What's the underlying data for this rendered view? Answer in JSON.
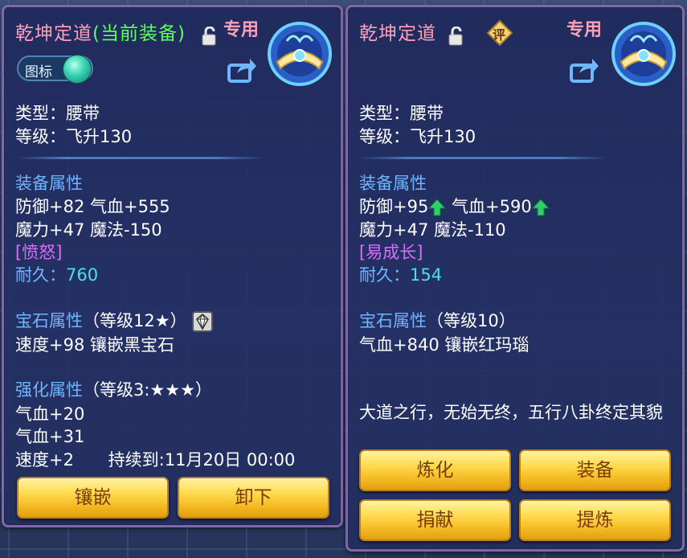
{
  "left_panel": {
    "title": "乾坤定道",
    "title_tag": "(当前装备)",
    "exclusive": "专用",
    "icon_toggle_label": "图标",
    "type_line": "类型：腰带",
    "level_line": "等级：飞升130",
    "attr_header": "装备属性",
    "attr_line1": "防御+82 气血+555",
    "attr_line2": "魔力+47 魔法-150",
    "special": "[愤怒]",
    "durability_label": "耐久：",
    "durability_value": "760",
    "gem_header": "宝石属性",
    "gem_level": "（等级12★）",
    "gem_line": "速度+98 镶嵌黑宝石",
    "enhance_header": "强化属性",
    "enhance_level": "（等级3:★★★）",
    "enhance_line1": "气血+20",
    "enhance_line2": "气血+31",
    "enhance_line3_stat": "速度+2",
    "enhance_line3_expire": "持续到:11月20日 00:00",
    "buttons": {
      "inlay": "镶嵌",
      "unequip": "卸下"
    }
  },
  "right_panel": {
    "title": "乾坤定道",
    "rate_badge": "评",
    "exclusive": "专用",
    "type_line": "类型：腰带",
    "level_line": "等级：飞升130",
    "attr_header": "装备属性",
    "attr_def": "防御+95",
    "attr_hp": "气血+590",
    "attr_line2": "魔力+47 魔法-110",
    "special": "[易成长]",
    "durability_label": "耐久：",
    "durability_value": "154",
    "gem_header": "宝石属性",
    "gem_level": "（等级10）",
    "gem_line": "气血+840 镶嵌红玛瑙",
    "description": "大道之行，无始无终，五行八卦终定其貌",
    "buttons": {
      "refine": "炼化",
      "equip": "装备",
      "donate": "捐献",
      "extract": "提炼"
    }
  },
  "colors": {
    "title": "#ff9fb8",
    "current_tag": "#5cff5c",
    "section_header": "#6fb6ff",
    "durability_value": "#48e0f0",
    "special_attr": "#e06cff",
    "upgrade_arrow": "#2fd06a",
    "button_fill": "#ffd94c"
  }
}
